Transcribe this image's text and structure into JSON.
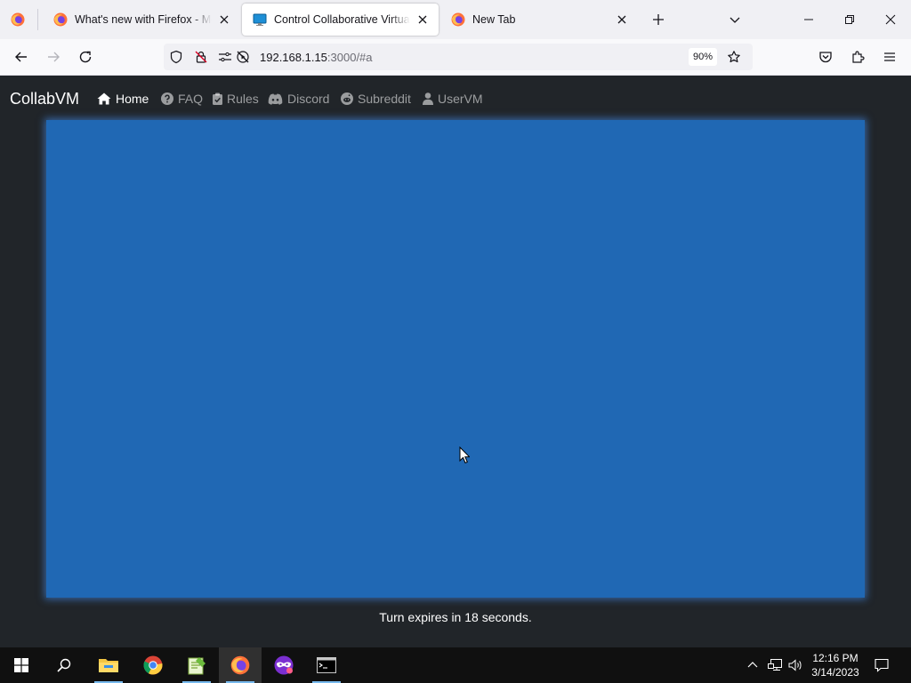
{
  "browser": {
    "tabs": [
      {
        "title": "What's new with Firefox - More"
      },
      {
        "title": "Control Collaborative Virtual M"
      },
      {
        "title": "New Tab"
      }
    ],
    "url": {
      "host": "192.168.1.15",
      "rest": ":3000/#a"
    },
    "zoom": "90%"
  },
  "site": {
    "brand": "CollabVM",
    "nav": [
      {
        "label": "Home",
        "icon": "home-icon"
      },
      {
        "label": "FAQ",
        "icon": "question-circle-icon"
      },
      {
        "label": "Rules",
        "icon": "clipboard-check-icon"
      },
      {
        "label": "Discord",
        "icon": "discord-icon"
      },
      {
        "label": "Subreddit",
        "icon": "reddit-icon"
      },
      {
        "label": "UserVM",
        "icon": "user-icon"
      }
    ],
    "turn_status": "Turn expires in 18 seconds.",
    "vm_color": "#2068b4"
  },
  "taskbar": {
    "time": "12:16 PM",
    "date": "3/14/2023"
  }
}
